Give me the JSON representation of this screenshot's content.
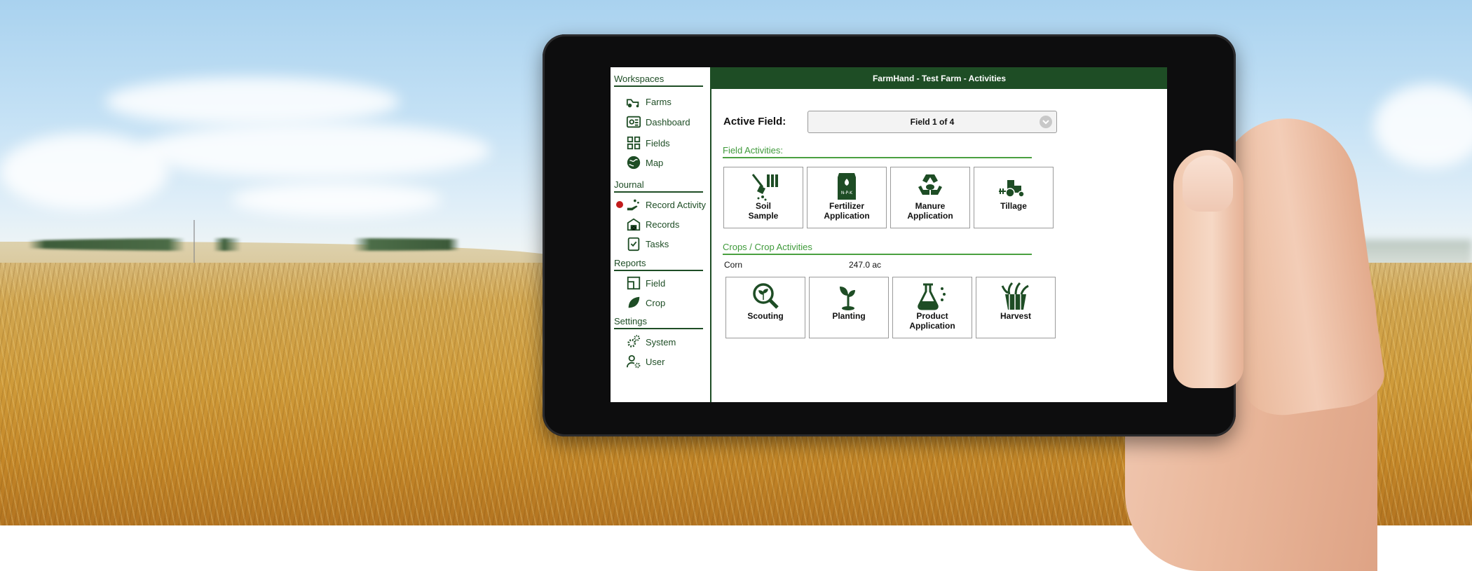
{
  "app": {
    "title": "FarmHand - Test Farm - Activities"
  },
  "sidebar": {
    "workspaces": {
      "heading": "Workspaces",
      "items": [
        {
          "label": "Farms",
          "icon": "tractor-icon"
        },
        {
          "label": "Dashboard",
          "icon": "dashboard-icon"
        },
        {
          "label": "Fields",
          "icon": "fields-grid-icon"
        },
        {
          "label": "Map",
          "icon": "globe-icon"
        }
      ]
    },
    "journal": {
      "heading": "Journal",
      "items": [
        {
          "label": "Record Activity",
          "icon": "hand-seed-icon",
          "active": true
        },
        {
          "label": "Records",
          "icon": "barn-icon"
        },
        {
          "label": "Tasks",
          "icon": "checklist-icon"
        }
      ]
    },
    "reports": {
      "heading": "Reports",
      "items": [
        {
          "label": "Field",
          "icon": "field-report-icon"
        },
        {
          "label": "Crop",
          "icon": "leaf-icon"
        }
      ]
    },
    "settings": {
      "heading": "Settings",
      "items": [
        {
          "label": "System",
          "icon": "gears-icon"
        },
        {
          "label": "User",
          "icon": "user-gear-icon"
        }
      ]
    }
  },
  "main": {
    "active_field": {
      "label": "Active Field:",
      "value": "Field 1 of 4"
    },
    "field_activities": {
      "heading": "Field Activities:",
      "tiles": [
        {
          "label": "Soil\nSample",
          "icon": "soil-sample-icon"
        },
        {
          "label": "Fertilizer\nApplication",
          "icon": "fertilizer-bag-icon"
        },
        {
          "label": "Manure\nApplication",
          "icon": "manure-recycle-icon"
        },
        {
          "label": "Tillage",
          "icon": "tractor-icon"
        }
      ]
    },
    "crops": {
      "heading": "Crops / Crop Activities",
      "crop_name": "Corn",
      "crop_area": "247.0 ac",
      "tiles": [
        {
          "label": "Scouting",
          "icon": "magnifier-plant-icon"
        },
        {
          "label": "Planting",
          "icon": "sprout-icon"
        },
        {
          "label": "Product\nApplication",
          "icon": "flask-icon"
        },
        {
          "label": "Harvest",
          "icon": "harvest-basket-icon"
        }
      ]
    }
  },
  "colors": {
    "brand_green": "#1e4d25",
    "accent_green": "#3f9a3b",
    "active_dot": "#c21c1c"
  }
}
